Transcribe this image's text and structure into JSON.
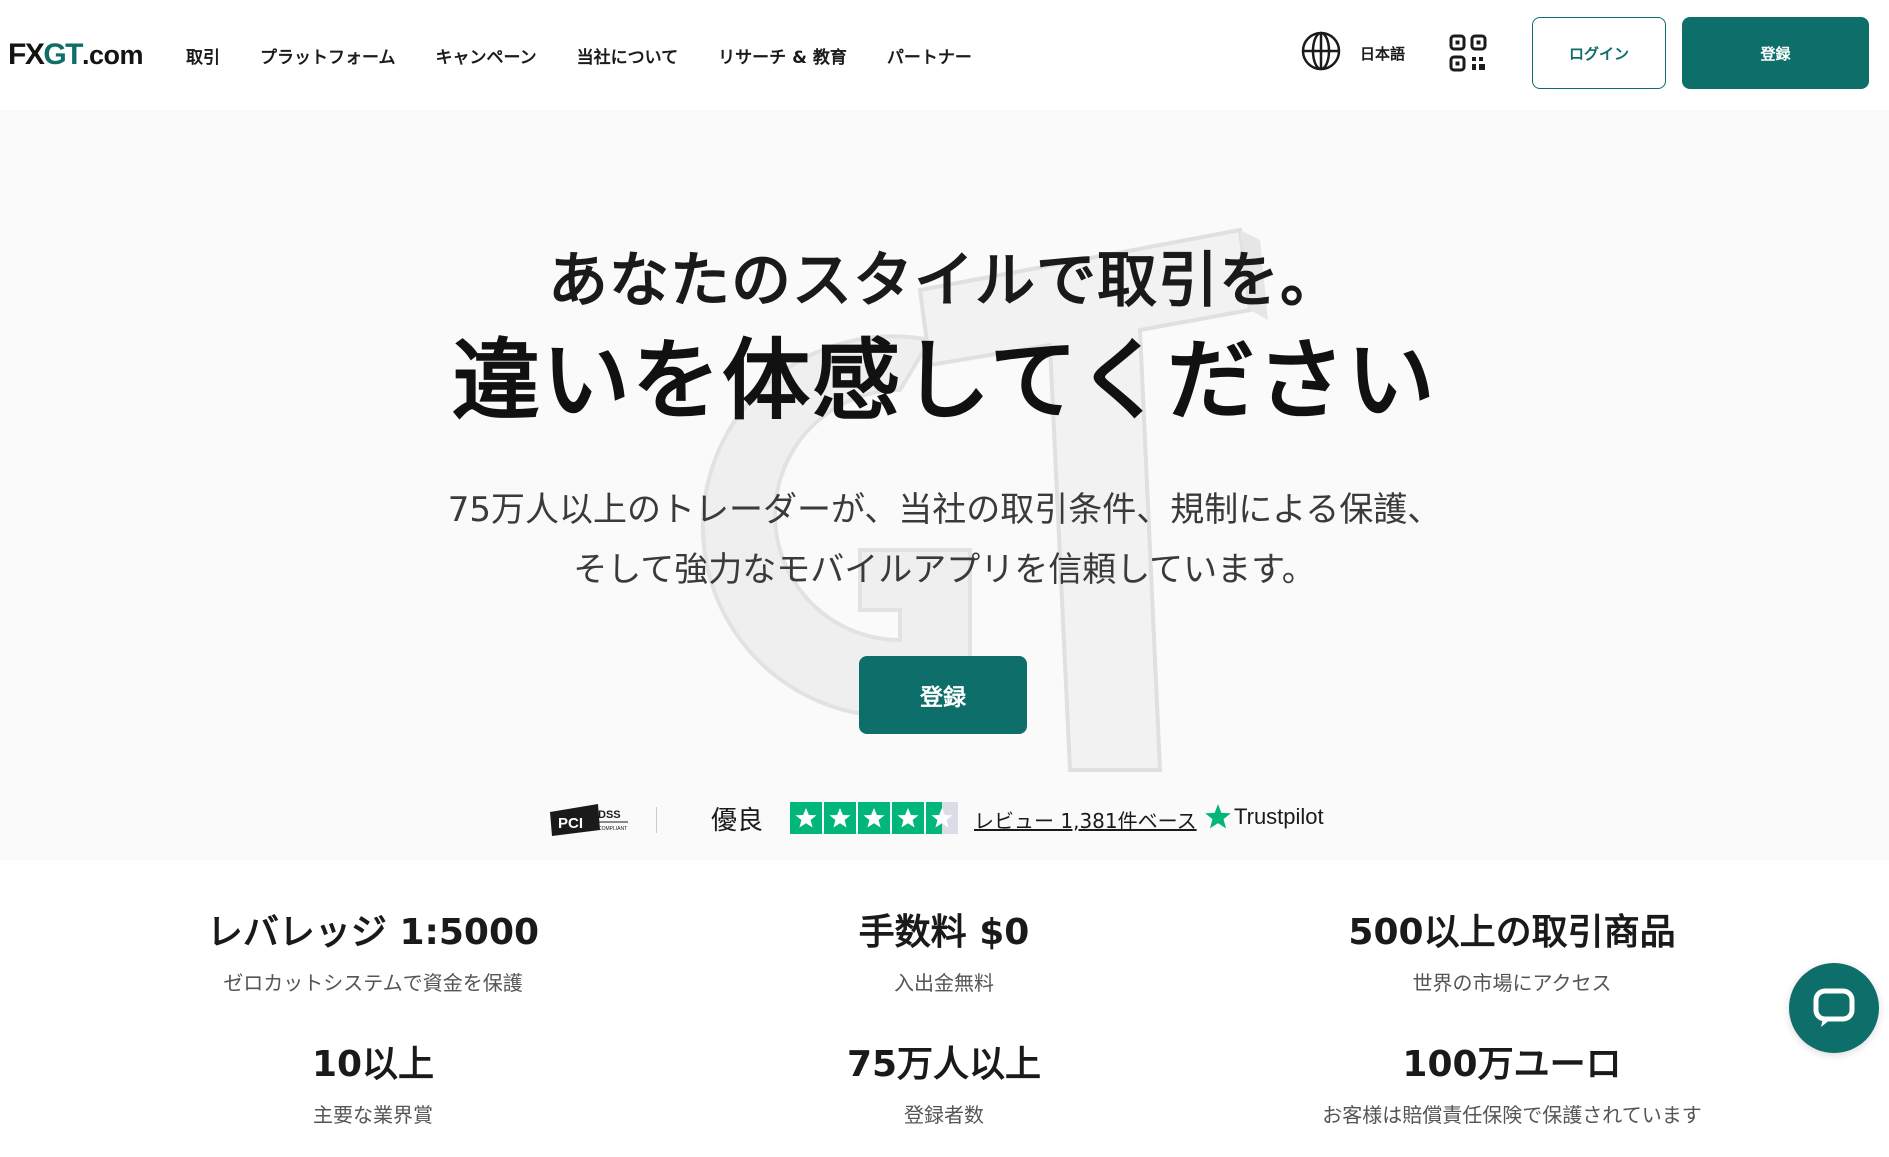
{
  "brand": {
    "logo_text_fx": "FX",
    "logo_text_gt": "GT",
    "logo_text_com": ".com",
    "primary_color": "#0d6e6a"
  },
  "nav": {
    "items": [
      {
        "label": "取引"
      },
      {
        "label": "プラットフォーム"
      },
      {
        "label": "キャンペーン"
      },
      {
        "label": "当社について"
      },
      {
        "label": "リサーチ & 教育"
      },
      {
        "label": "パートナー"
      }
    ],
    "language_label": "日本語",
    "language_icon": "globe-icon",
    "qr_icon": "qr-code-icon",
    "login_label": "ログイン",
    "register_label": "登録"
  },
  "hero": {
    "title_line1": "あなたのスタイルで取引を。",
    "title_line2": "違いを体感してください",
    "subtitle_line1": "75万人以上のトレーダーが、当社の取引条件、規制による保護、",
    "subtitle_line2": "そして強力なモバイルアプリを信頼しています。",
    "cta_label": "登録"
  },
  "trust": {
    "pci_label": "PCI DSS",
    "rating_label": "優良",
    "stars_value": 4.5,
    "stars_max": 5,
    "review_text": "レビュー 1,381件ベース",
    "trustpilot_label": "Trustpilot",
    "trustpilot_color": "#00b67a"
  },
  "stats": [
    {
      "title": "レバレッジ 1:5000",
      "desc": "ゼロカットシステムで資金を保護"
    },
    {
      "title": "手数料 $0",
      "desc": "入出金無料"
    },
    {
      "title": "500以上の取引商品",
      "desc": "世界の市場にアクセス"
    },
    {
      "title": "10以上",
      "desc": "主要な業界賞"
    },
    {
      "title": "75万人以上",
      "desc": "登録者数"
    },
    {
      "title": "100万ユーロ",
      "desc": "お客様は賠償責任保険で保護されています"
    }
  ],
  "chat": {
    "icon": "chat-bubble-icon"
  }
}
